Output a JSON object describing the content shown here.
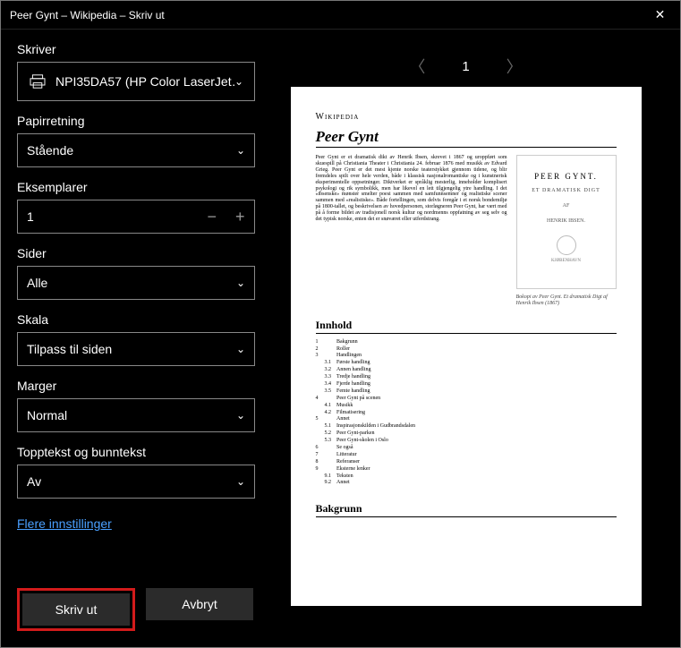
{
  "titlebar": {
    "title": "Peer Gynt – Wikipedia – Skriv ut",
    "close_icon": "✕"
  },
  "panel": {
    "printer": {
      "label": "Skriver",
      "selected": "NPI35DA57 (HP Color LaserJet…"
    },
    "orientation": {
      "label": "Papirretning",
      "selected": "Stående"
    },
    "copies": {
      "label": "Eksemplarer",
      "value": "1"
    },
    "pages": {
      "label": "Sider",
      "selected": "Alle"
    },
    "scale": {
      "label": "Skala",
      "selected": "Tilpass til siden"
    },
    "margins": {
      "label": "Marger",
      "selected": "Normal"
    },
    "headerfooter": {
      "label": "Topptekst og bunntekst",
      "selected": "Av"
    },
    "more_link": "Flere innstillinger",
    "print_button": "Skriv ut",
    "cancel_button": "Avbryt"
  },
  "pager": {
    "current": "1"
  },
  "preview": {
    "site_name": "Wikipedia",
    "article_title": "Peer Gynt",
    "lead_text": "Peer Gynt er et dramatisk dikt av Henrik Ibsen, skrevet i 1867 og uroppført som skuespill på Christiania Theater i Christiania 24. februar 1876 med musikk av Edvard Grieg. Peer Gynt er det mest kjente norske teaterstykket gjennom tidene, og blir fremdeles spilt over hele verden, både i klassisk nasjonalromantiske og i kunstnerisk eksperimentelle oppsetninger. Diktverket er språklig mesterlig, inneholder komplisert psykologi og rik symbolikk, men har likevel en lett tilgjengelig ytre handling. I det «ibsenske» mønster smelter poesi sammen med samfunnsemner og realistiske scener sammen med «realistiske». Både fortellingen, som delvis foregår i et norsk bondemiljø på 1800-tallet, og beskrivelsen av hovedpersonen, storløgneren Peer Gynt, har vært med på å forme bildet av tradisjonell norsk kultur og nordmenns oppfatning av seg selv og det typisk norske, enten det er snøværet eller utferdstrang.",
    "infobox": {
      "title": "PEER GYNT.",
      "subtitle": "ET DRAMATISK DIGT",
      "by": "AF",
      "author": "HENRIK IBSEN.",
      "publisher": "KJØBENHAVN",
      "caption": "Bokopi av Peer Gynt. Et dramatisk Digt af Henrik Ibsen (1867)"
    },
    "toc_heading": "Innhold",
    "toc": [
      {
        "n": "1",
        "t": "Bakgrunn"
      },
      {
        "n": "2",
        "t": "Roller"
      },
      {
        "n": "3",
        "t": "Handlingen"
      },
      {
        "n": "3.1",
        "t": "Første handling",
        "sub": true
      },
      {
        "n": "3.2",
        "t": "Annen handling",
        "sub": true
      },
      {
        "n": "3.3",
        "t": "Tredje handling",
        "sub": true
      },
      {
        "n": "3.4",
        "t": "Fjerde handling",
        "sub": true
      },
      {
        "n": "3.5",
        "t": "Femte handling",
        "sub": true
      },
      {
        "n": "4",
        "t": "Peer Gynt på scenen"
      },
      {
        "n": "4.1",
        "t": "Musikk",
        "sub": true
      },
      {
        "n": "4.2",
        "t": "Filmatisering",
        "sub": true
      },
      {
        "n": "5",
        "t": "Annet"
      },
      {
        "n": "5.1",
        "t": "Inspirasjonskilden i Gudbrandsdalen",
        "sub": true
      },
      {
        "n": "5.2",
        "t": "Peer Gynt-parken",
        "sub": true
      },
      {
        "n": "5.3",
        "t": "Peer Gynt-skolen i Oslo",
        "sub": true
      },
      {
        "n": "6",
        "t": "Se også"
      },
      {
        "n": "7",
        "t": "Litteratur"
      },
      {
        "n": "8",
        "t": "Referanser"
      },
      {
        "n": "9",
        "t": "Eksterne lenker"
      },
      {
        "n": "9.1",
        "t": "Teksten",
        "sub": true
      },
      {
        "n": "9.2",
        "t": "Annet",
        "sub": true
      }
    ],
    "section_heading": "Bakgrunn"
  }
}
